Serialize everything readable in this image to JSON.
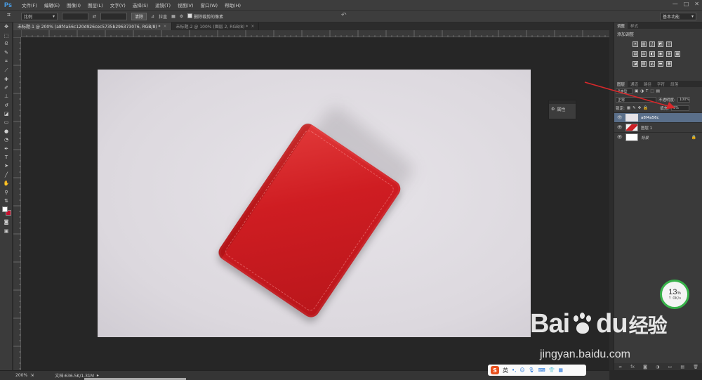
{
  "app": {
    "logo": "Ps"
  },
  "menu": [
    "文件(F)",
    "编辑(E)",
    "图像(I)",
    "图层(L)",
    "文字(Y)",
    "选择(S)",
    "滤镜(T)",
    "视图(V)",
    "窗口(W)",
    "帮助(H)"
  ],
  "window_controls": [
    "—",
    "□",
    "✕"
  ],
  "options": {
    "ratio_select": "比例",
    "clear_button": "清除",
    "straighten_label": "拉直",
    "delete_cropped_label": "删除裁剪的像素",
    "workspace": "基本功能"
  },
  "tabs": [
    {
      "label": "未标题-1 @ 200% (a8f4a56c120d926cec5735b296373076, RGB/8) *",
      "close": "×"
    },
    {
      "label": "未标题-2 @ 100% (图层 2, RGB/8) *",
      "close": "×"
    }
  ],
  "float_panel": {
    "label": "属性"
  },
  "adjustments": {
    "tabs": [
      "调整",
      "样式"
    ],
    "title": "添加调整"
  },
  "layers": {
    "tabs": [
      "图层",
      "通道",
      "路径",
      "字符",
      "段落"
    ],
    "filter_select": "类型",
    "blend_mode": "正常",
    "opacity_label": "不透明度:",
    "opacity_value": "100%",
    "lock_label": "锁定:",
    "fill_label": "填充:",
    "fill_value": "0%",
    "items": [
      {
        "name": "a8f4a56c",
        "selected": true
      },
      {
        "name": "图层 1",
        "selected": false
      },
      {
        "name": "背景",
        "selected": false
      }
    ]
  },
  "status": {
    "zoom": "200%",
    "doc_info": "文档:636.5K/1.31M"
  },
  "network": {
    "percent": "13",
    "percent_sign": "%",
    "speed": "0K/s"
  },
  "ime": {
    "lang": "英"
  },
  "watermark": {
    "brand_a": "Bai",
    "brand_b": "du",
    "brand_cn": "经验",
    "url": "jingyan.baidu.com"
  },
  "colors": {
    "accent_arrow": "#d8282b",
    "foreground": "#ffffff",
    "background": "#c8102e"
  }
}
